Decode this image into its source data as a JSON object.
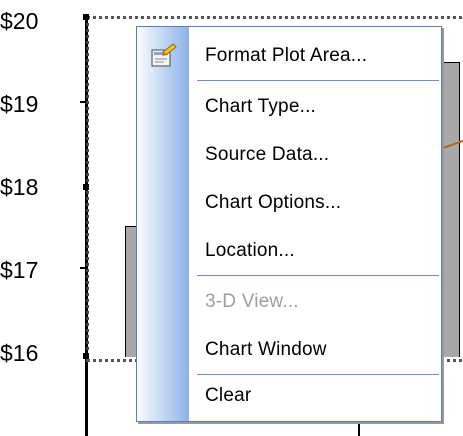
{
  "chart": {
    "y_ticks": [
      "$20",
      "$19",
      "$18",
      "$17",
      "$16"
    ]
  },
  "context_menu": {
    "items": [
      {
        "label": "Format Plot Area...",
        "icon": "format-plot-area-icon",
        "enabled": true
      },
      {
        "label": "Chart Type...",
        "enabled": true
      },
      {
        "label": "Source Data...",
        "enabled": true
      },
      {
        "label": "Chart Options...",
        "enabled": true
      },
      {
        "label": "Location...",
        "enabled": true
      },
      {
        "label": "3-D View...",
        "enabled": false
      },
      {
        "label": "Chart Window",
        "enabled": true
      },
      {
        "label": "Clear",
        "enabled": true
      }
    ]
  },
  "colors": {
    "menu_border": "#5a7fbf",
    "menu_strip": "#8fb1e6",
    "disabled_text": "#9e9e9e",
    "bar_gray": "#a8a8a8",
    "trend_line": "#b5651d"
  }
}
